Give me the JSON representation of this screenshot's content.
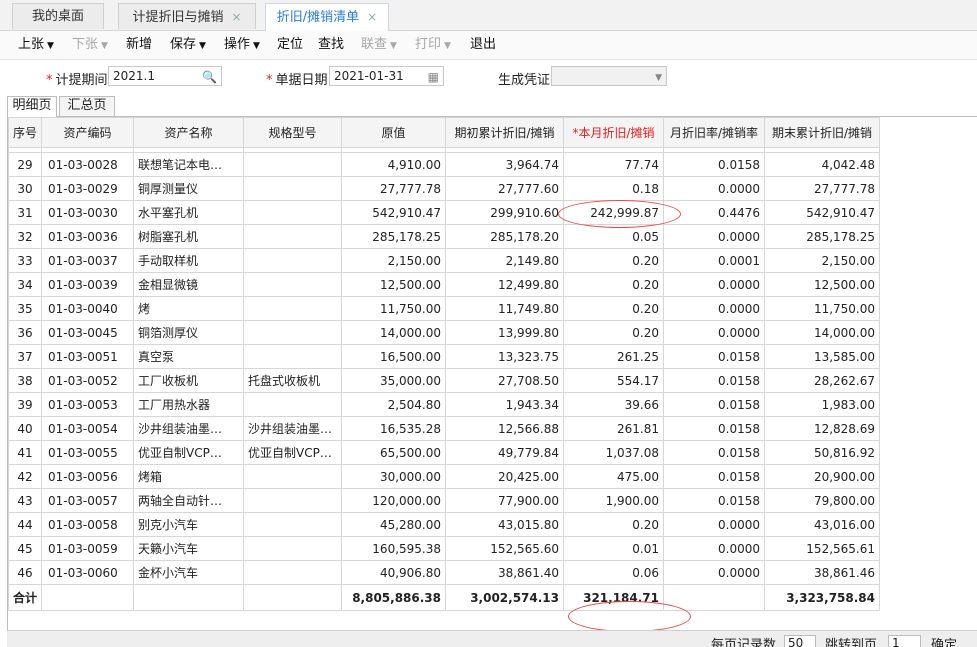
{
  "tabs": [
    {
      "label": "我的桌面",
      "closable": false
    },
    {
      "label": "计提折旧与摊销",
      "closable": true
    },
    {
      "label": "折旧/摊销清单",
      "closable": true
    }
  ],
  "close_glyph": "×",
  "toolbar": {
    "prev": "上张",
    "next": "下张",
    "new": "新增",
    "save": "保存",
    "ops": "操作",
    "locate": "定位",
    "find": "查找",
    "link": "联查",
    "print": "打印",
    "exit": "退出"
  },
  "form": {
    "period_label": "计提期间",
    "period_value": "2021.1",
    "date_label": "单据日期",
    "date_value": "2021-01-31",
    "voucher_label": "生成凭证",
    "voucher_value": "",
    "required_mark": "*"
  },
  "subtabs": [
    "明细页",
    "汇总页"
  ],
  "columns": [
    "序号",
    "资产编码",
    "资产名称",
    "规格型号",
    "原值",
    "期初累计折旧/摊销",
    "*本月折旧/摊销",
    "月折旧率/摊销率",
    "期末累计折旧/摊销"
  ],
  "rows": [
    [
      "29",
      "01-03-0028",
      "联想笔记本电…",
      "",
      "4,910.00",
      "3,964.74",
      "77.74",
      "0.0158",
      "4,042.48"
    ],
    [
      "30",
      "01-03-0029",
      "铜厚测量仪",
      "",
      "27,777.78",
      "27,777.60",
      "0.18",
      "0.0000",
      "27,777.78"
    ],
    [
      "31",
      "01-03-0030",
      "水平塞孔机",
      "",
      "542,910.47",
      "299,910.60",
      "242,999.87",
      "0.4476",
      "542,910.47"
    ],
    [
      "32",
      "01-03-0036",
      "树脂塞孔机",
      "",
      "285,178.25",
      "285,178.20",
      "0.05",
      "0.0000",
      "285,178.25"
    ],
    [
      "33",
      "01-03-0037",
      "手动取样机",
      "",
      "2,150.00",
      "2,149.80",
      "0.20",
      "0.0001",
      "2,150.00"
    ],
    [
      "34",
      "01-03-0039",
      "金相显微镜",
      "",
      "12,500.00",
      "12,499.80",
      "0.20",
      "0.0000",
      "12,500.00"
    ],
    [
      "35",
      "01-03-0040",
      "烤",
      "",
      "11,750.00",
      "11,749.80",
      "0.20",
      "0.0000",
      "11,750.00"
    ],
    [
      "36",
      "01-03-0045",
      "铜箔测厚仪",
      "",
      "14,000.00",
      "13,999.80",
      "0.20",
      "0.0000",
      "14,000.00"
    ],
    [
      "37",
      "01-03-0051",
      "真空泵",
      "",
      "16,500.00",
      "13,323.75",
      "261.25",
      "0.0158",
      "13,585.00"
    ],
    [
      "38",
      "01-03-0052",
      "工厂收板机",
      "托盘式收板机",
      "35,000.00",
      "27,708.50",
      "554.17",
      "0.0158",
      "28,262.67"
    ],
    [
      "39",
      "01-03-0053",
      "工厂用热水器",
      "",
      "2,504.80",
      "1,943.34",
      "39.66",
      "0.0158",
      "1,983.00"
    ],
    [
      "40",
      "01-03-0054",
      "沙井组装油墨…",
      "沙井组装油墨…",
      "16,535.28",
      "12,566.88",
      "261.81",
      "0.0158",
      "12,828.69"
    ],
    [
      "41",
      "01-03-0055",
      "优亚自制VCP…",
      "优亚自制VCP…",
      "65,500.00",
      "49,779.84",
      "1,037.08",
      "0.0158",
      "50,816.92"
    ],
    [
      "42",
      "01-03-0056",
      "烤箱",
      "",
      "30,000.00",
      "20,425.00",
      "475.00",
      "0.0158",
      "20,900.00"
    ],
    [
      "43",
      "01-03-0057",
      "两轴全自动针…",
      "",
      "120,000.00",
      "77,900.00",
      "1,900.00",
      "0.0158",
      "79,800.00"
    ],
    [
      "44",
      "01-03-0058",
      "别克小汽车",
      "",
      "45,280.00",
      "43,015.80",
      "0.20",
      "0.0000",
      "43,016.00"
    ],
    [
      "45",
      "01-03-0059",
      "天籁小汽车",
      "",
      "160,595.38",
      "152,565.60",
      "0.01",
      "0.0000",
      "152,565.61"
    ],
    [
      "46",
      "01-03-0060",
      "金杯小汽车",
      "",
      "40,906.80",
      "38,861.40",
      "0.06",
      "0.0000",
      "38,861.46"
    ]
  ],
  "totals": {
    "label": "合计",
    "original": "8,805,886.38",
    "opening": "3,002,574.13",
    "current": "321,184.71",
    "closing": "3,323,758.84"
  },
  "pager": {
    "per_page_label": "每页记录数",
    "per_page": "50",
    "goto_label": "跳转到页",
    "goto_page": "1",
    "confirm": "确定"
  },
  "colors": {
    "accent": "#2b7bd6",
    "required": "#e02020",
    "annotation": "#e24b4b"
  }
}
